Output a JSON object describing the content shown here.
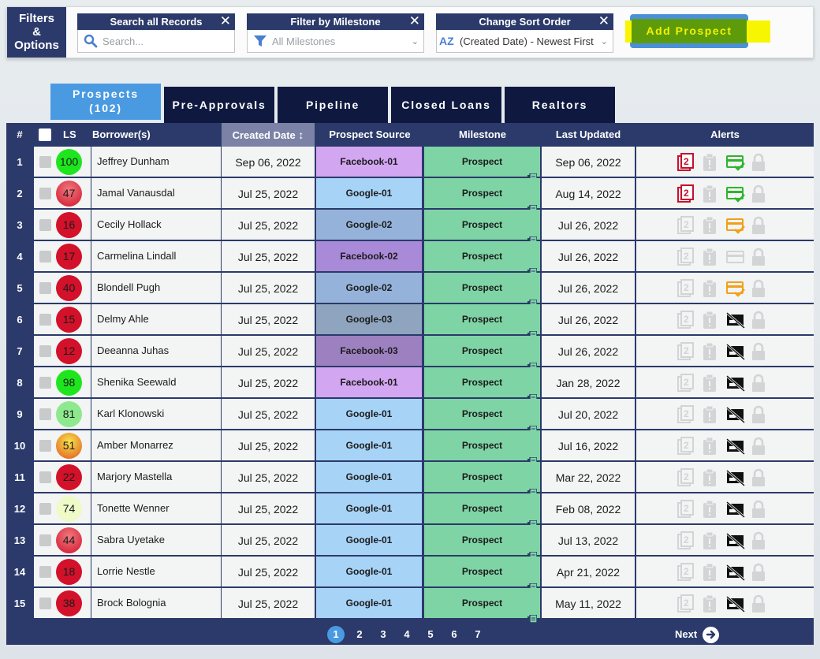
{
  "filters_button": {
    "line1": "Filters",
    "line2": "&",
    "line3": "Options"
  },
  "search": {
    "title": "Search all Records",
    "placeholder": "Search..."
  },
  "milestone_filter": {
    "title": "Filter by Milestone",
    "value": "All Milestones"
  },
  "sort_order": {
    "title": "Change Sort Order",
    "value": "(Created Date) - Newest First",
    "icon_text": "AZ"
  },
  "add_prospect": {
    "label": "Add Prospect"
  },
  "tabs": [
    {
      "label": "Prospects",
      "count": "(102)",
      "active": true
    },
    {
      "label": "Pre-Approvals"
    },
    {
      "label": "Pipeline"
    },
    {
      "label": "Closed Loans"
    },
    {
      "label": "Realtors"
    }
  ],
  "columns": {
    "num": "#",
    "ls": "LS",
    "borrower": "Borrower(s)",
    "created": "Created Date",
    "created_sort_icon": "↕",
    "source": "Prospect Source",
    "milestone": "Milestone",
    "updated": "Last Updated",
    "alerts": "Alerts"
  },
  "colors": {
    "header_bg": "#2b3a6a",
    "tab_bg": "#0f1940",
    "tab_active": "#4a9ae2",
    "milestone_bg": "#7fd4a6",
    "source": {
      "Facebook-01": "#d3a6f2",
      "Facebook-02": "#a98ad8",
      "Facebook-03": "#9d80bf",
      "Google-01": "#a7d3f7",
      "Google-02": "#95b3da",
      "Google-03": "#8ea4bf"
    },
    "ls": {
      "green": "#1ee61e",
      "light_green": "#8ee98e",
      "pale": "#eefac8",
      "red": "#d3112a",
      "red_light": "#e0474f",
      "orange": "#f2a018"
    },
    "alert_red": "#c8102e",
    "alert_green": "#2db52d",
    "alert_orange": "#f2a018",
    "alert_muted": "#d2d4d6"
  },
  "rows": [
    {
      "n": "1",
      "ls": "100",
      "ls_color": "green",
      "name": "Jeffrey Dunham",
      "created": "Sep 06, 2022",
      "source": "Facebook-01",
      "milestone": "Prospect",
      "updated": "Sep 06, 2022",
      "alerts": [
        "doc-red",
        "clip",
        "card-green",
        "lock"
      ]
    },
    {
      "n": "2",
      "ls": "47",
      "ls_color": "red_light",
      "name": "Jamal Vanausdal",
      "created": "Jul 25, 2022",
      "source": "Google-01",
      "milestone": "Prospect",
      "updated": "Aug 14, 2022",
      "alerts": [
        "doc-red",
        "clip",
        "card-green",
        "lock"
      ]
    },
    {
      "n": "3",
      "ls": "16",
      "ls_color": "red",
      "name": "Cecily Hollack",
      "created": "Jul 25, 2022",
      "source": "Google-02",
      "milestone": "Prospect",
      "updated": "Jul 26, 2022",
      "alerts": [
        "doc",
        "clip",
        "card-orange",
        "lock"
      ]
    },
    {
      "n": "4",
      "ls": "17",
      "ls_color": "red",
      "name": "Carmelina Lindall",
      "created": "Jul 25, 2022",
      "source": "Facebook-02",
      "milestone": "Prospect",
      "updated": "Jul 26, 2022",
      "alerts": [
        "doc",
        "clip",
        "card-muted",
        "lock"
      ]
    },
    {
      "n": "5",
      "ls": "40",
      "ls_color": "red",
      "name": "Blondell Pugh",
      "created": "Jul 25, 2022",
      "source": "Google-02",
      "milestone": "Prospect",
      "updated": "Jul 26, 2022",
      "alerts": [
        "doc",
        "clip",
        "card-orange",
        "lock"
      ]
    },
    {
      "n": "6",
      "ls": "15",
      "ls_color": "red",
      "name": "Delmy Ahle",
      "created": "Jul 25, 2022",
      "source": "Google-03",
      "milestone": "Prospect",
      "updated": "Jul 26, 2022",
      "alerts": [
        "doc",
        "clip",
        "card-off",
        "lock"
      ]
    },
    {
      "n": "7",
      "ls": "12",
      "ls_color": "red",
      "name": "Deeanna Juhas",
      "created": "Jul 25, 2022",
      "source": "Facebook-03",
      "milestone": "Prospect",
      "updated": "Jul 26, 2022",
      "alerts": [
        "doc",
        "clip",
        "card-off",
        "lock"
      ]
    },
    {
      "n": "8",
      "ls": "98",
      "ls_color": "green",
      "name": "Shenika Seewald",
      "created": "Jul 25, 2022",
      "source": "Facebook-01",
      "milestone": "Prospect",
      "updated": "Jan 28, 2022",
      "alerts": [
        "doc",
        "clip",
        "card-off",
        "lock"
      ]
    },
    {
      "n": "9",
      "ls": "81",
      "ls_color": "light_green",
      "name": "Karl Klonowski",
      "created": "Jul 25, 2022",
      "source": "Google-01",
      "milestone": "Prospect",
      "updated": "Jul 20, 2022",
      "alerts": [
        "doc",
        "clip",
        "card-off",
        "lock"
      ]
    },
    {
      "n": "10",
      "ls": "51",
      "ls_color": "orange",
      "name": "Amber Monarrez",
      "created": "Jul 25, 2022",
      "source": "Google-01",
      "milestone": "Prospect",
      "updated": "Jul 16, 2022",
      "alerts": [
        "doc",
        "clip",
        "card-off",
        "lock"
      ]
    },
    {
      "n": "11",
      "ls": "22",
      "ls_color": "red",
      "name": "Marjory Mastella",
      "created": "Jul 25, 2022",
      "source": "Google-01",
      "milestone": "Prospect",
      "updated": "Mar 22, 2022",
      "alerts": [
        "doc",
        "clip",
        "card-off",
        "lock"
      ]
    },
    {
      "n": "12",
      "ls": "74",
      "ls_color": "pale",
      "name": "Tonette Wenner",
      "created": "Jul 25, 2022",
      "source": "Google-01",
      "milestone": "Prospect",
      "updated": "Feb 08, 2022",
      "alerts": [
        "doc",
        "clip",
        "card-off",
        "lock"
      ]
    },
    {
      "n": "13",
      "ls": "44",
      "ls_color": "red_light",
      "name": "Sabra Uyetake",
      "created": "Jul 25, 2022",
      "source": "Google-01",
      "milestone": "Prospect",
      "updated": "Jul 13, 2022",
      "alerts": [
        "doc",
        "clip",
        "card-off",
        "lock"
      ]
    },
    {
      "n": "14",
      "ls": "18",
      "ls_color": "red",
      "name": "Lorrie Nestle",
      "created": "Jul 25, 2022",
      "source": "Google-01",
      "milestone": "Prospect",
      "updated": "Apr 21, 2022",
      "alerts": [
        "doc",
        "clip",
        "card-off",
        "lock"
      ]
    },
    {
      "n": "15",
      "ls": "38",
      "ls_color": "red",
      "name": "Brock Bolognia",
      "created": "Jul 25, 2022",
      "source": "Google-01",
      "milestone": "Prospect",
      "updated": "May 11, 2022",
      "alerts": [
        "doc",
        "clip",
        "card-off",
        "lock"
      ]
    }
  ],
  "pagination": {
    "pages": [
      "1",
      "2",
      "3",
      "4",
      "5",
      "6",
      "7"
    ],
    "current": "1",
    "next_label": "Next"
  }
}
